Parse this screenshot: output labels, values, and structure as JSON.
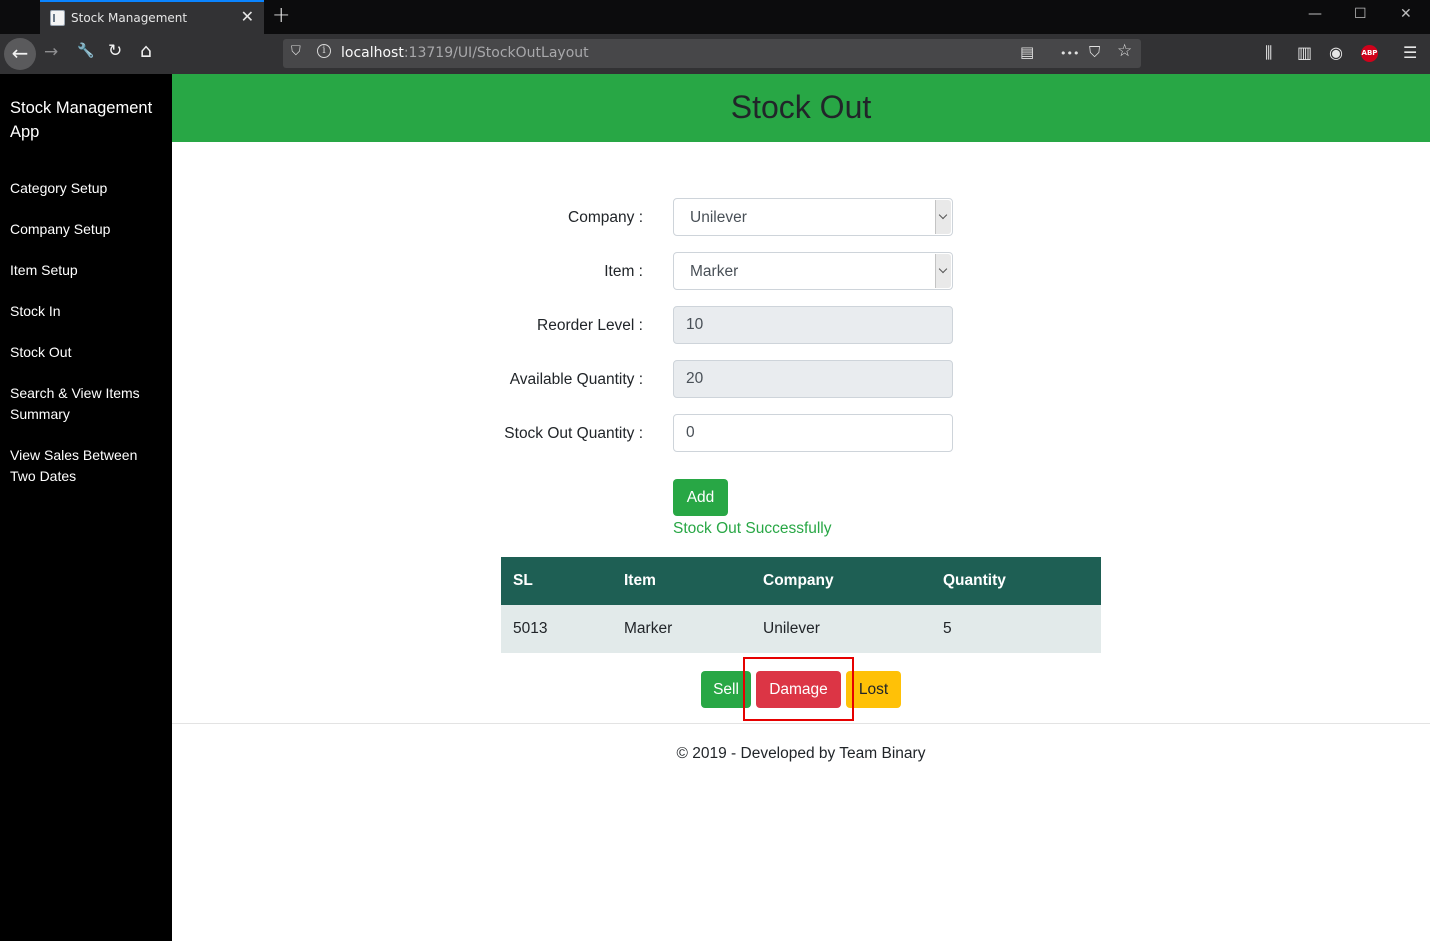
{
  "browser": {
    "tab_title": "Stock Management",
    "tab_close": "✕",
    "new_tab": "+",
    "window_controls": {
      "minimize": "—",
      "maximize": "☐",
      "close": "✕"
    },
    "nav": {
      "back": "←",
      "forward": "→",
      "tools": "🔧",
      "reload": "↻",
      "home": "⌂"
    },
    "url_host": "localhost",
    "url_rest": ":13719/UI/StockOutLayout",
    "url_icons": {
      "shield": "⛉",
      "info": "i",
      "reader": "▤",
      "more": "•••",
      "pocket": "⛉",
      "bookmark": "☆"
    },
    "toolbar_icons": {
      "library": "⫼",
      "sidebar": "▥",
      "account": "◉",
      "abp": "ABP",
      "menu": "☰"
    }
  },
  "sidebar": {
    "brand": "Stock Management App",
    "items": [
      {
        "label": "Category Setup"
      },
      {
        "label": "Company Setup"
      },
      {
        "label": "Item Setup"
      },
      {
        "label": "Stock In"
      },
      {
        "label": "Stock Out"
      },
      {
        "label": "Search & View Items Summary"
      },
      {
        "label": "View Sales Between Two Dates"
      }
    ]
  },
  "header": {
    "title": "Stock Out"
  },
  "form": {
    "company_label": "Company :",
    "company_value": "Unilever",
    "item_label": "Item :",
    "item_value": "Marker",
    "reorder_label": "Reorder Level :",
    "reorder_value": "10",
    "available_label": "Available Quantity :",
    "available_value": "20",
    "stockout_label": "Stock Out Quantity :",
    "stockout_value": "0",
    "add_button": "Add",
    "success_message": "Stock Out Successfully"
  },
  "table": {
    "headers": [
      "SL",
      "Item",
      "Company",
      "Quantity"
    ],
    "rows": [
      [
        "5013",
        "Marker",
        "Unilever",
        "5"
      ]
    ]
  },
  "actions": {
    "sell": "Sell",
    "damage": "Damage",
    "lost": "Lost"
  },
  "footer": {
    "text": "© 2019 - Developed by Team Binary"
  }
}
